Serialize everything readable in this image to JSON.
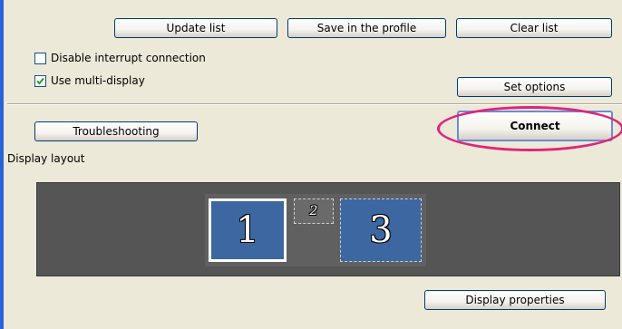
{
  "buttons": {
    "update_list": "Update list",
    "save_profile": "Save in the profile",
    "clear_list": "Clear list",
    "set_options": "Set options",
    "troubleshooting": "Troubleshooting",
    "connect": "Connect",
    "display_properties": "Display properties"
  },
  "options": {
    "disable_interrupt": {
      "label": "Disable interrupt connection",
      "checked": false
    },
    "multi_display": {
      "label": "Use multi-display",
      "checked": true
    }
  },
  "layout": {
    "heading": "Display layout",
    "monitors": [
      {
        "label": "1",
        "selected": true
      },
      {
        "label": "2",
        "selected": false
      },
      {
        "label": "3",
        "selected": false
      }
    ]
  },
  "colors": {
    "panel_bg": "#ece9d8",
    "monitor_blue": "#3c67a0",
    "highlight": "#e0257a"
  }
}
